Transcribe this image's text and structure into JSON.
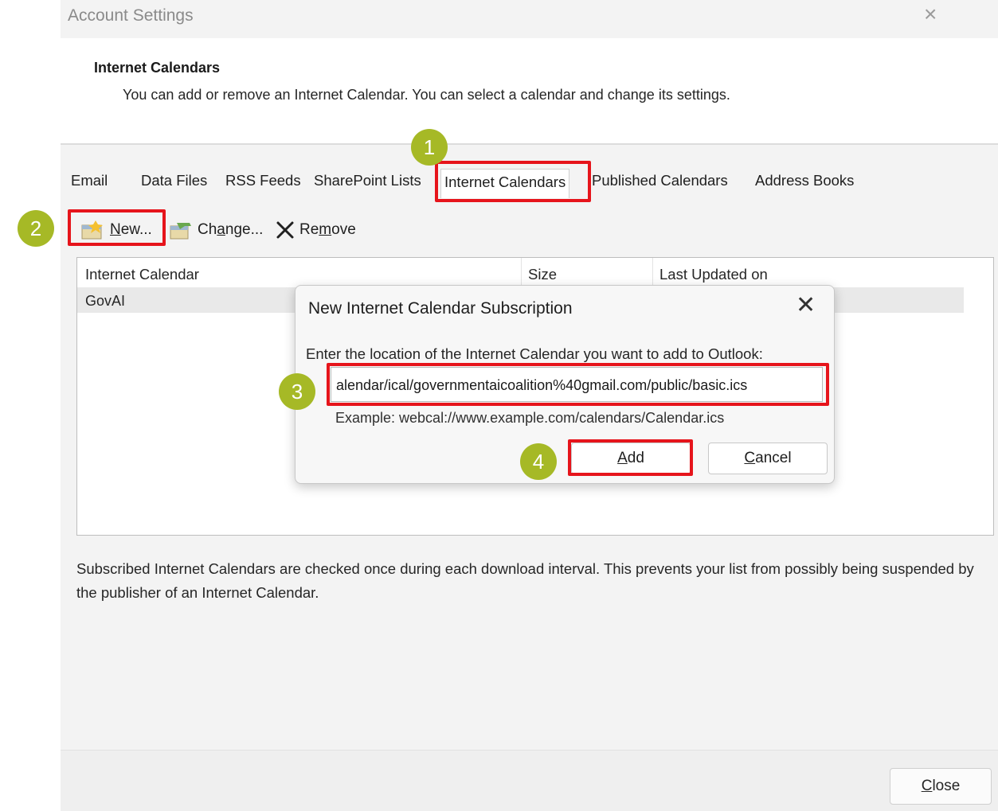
{
  "window": {
    "title": "Account Settings",
    "close_glyph": "×"
  },
  "header": {
    "title": "Internet Calendars",
    "description": "You can add or remove an Internet Calendar. You can select a calendar and change its settings."
  },
  "tabs": [
    {
      "label": "Email"
    },
    {
      "label": "Data Files"
    },
    {
      "label": "RSS Feeds"
    },
    {
      "label": "SharePoint Lists"
    },
    {
      "label": "Internet Calendars",
      "active": true
    },
    {
      "label": "Published Calendars"
    },
    {
      "label": "Address Books"
    }
  ],
  "toolbar": {
    "new_label_u": "N",
    "new_label_rest": "ew...",
    "change_label_a": "Ch",
    "change_label_u": "a",
    "change_label_rest": "nge...",
    "remove_label_a": "Re",
    "remove_label_u": "m",
    "remove_label_rest": "ove",
    "new_icon": "new-calendar-icon",
    "change_icon": "change-calendar-icon",
    "remove_icon": "x-icon"
  },
  "list": {
    "columns": [
      "Internet Calendar",
      "Size",
      "Last Updated on"
    ],
    "rows": [
      {
        "name": "GovAI"
      }
    ]
  },
  "footer_note": "Subscribed Internet Calendars are checked once during each download interval. This prevents your list from possibly being suspended by the publisher of an Internet Calendar.",
  "close_button": {
    "u": "C",
    "rest": "lose"
  },
  "dialog": {
    "title": "New Internet Calendar Subscription",
    "close_glyph": "✕",
    "prompt": "Enter the location of the Internet Calendar you want to add to Outlook:",
    "input_value": "alendar/ical/governmentaicoalition%40gmail.com/public/basic.ics",
    "example": "Example: webcal://www.example.com/calendars/Calendar.ics",
    "add_u": "A",
    "add_rest": "dd",
    "cancel_u": "C",
    "cancel_rest": "ancel"
  },
  "annotations": {
    "highlight_color": "#e6141b",
    "badge_color": "#a6b926",
    "steps": [
      "1",
      "2",
      "3",
      "4"
    ]
  }
}
